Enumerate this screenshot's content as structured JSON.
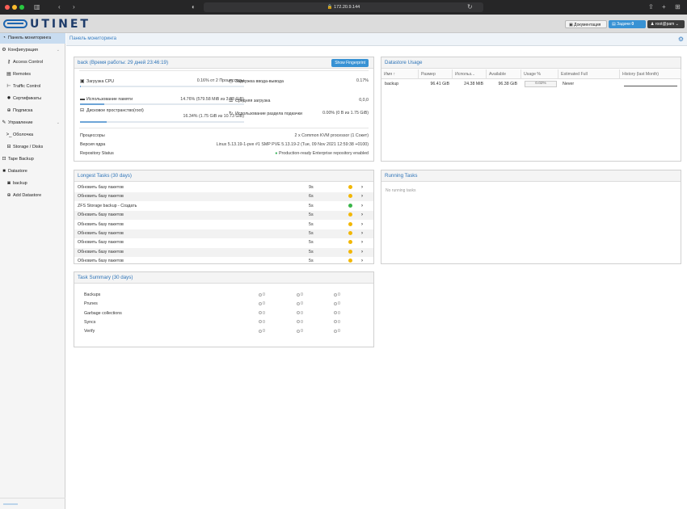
{
  "browser": {
    "url": "172.20.9.144",
    "traffic_colors": [
      "#ff5f57",
      "#febc2e",
      "#28c840"
    ]
  },
  "header": {
    "logo_text": "UTINET",
    "doc_label": "Документация",
    "tasks_label": "Задачи",
    "tasks_count": "0",
    "user_label": "root@pam"
  },
  "sidebar": {
    "items": [
      {
        "label": "Панель мониторинга",
        "icon": "dashboard-icon",
        "glyph": "◔",
        "indent": false,
        "active": true
      },
      {
        "label": "Конфигурация",
        "icon": "gears-icon",
        "glyph": "⚙",
        "indent": false,
        "chevron": true
      },
      {
        "label": "Access Control",
        "icon": "key-icon",
        "glyph": "⚷",
        "indent": true
      },
      {
        "label": "Remotes",
        "icon": "server-icon",
        "glyph": "▤",
        "indent": true
      },
      {
        "label": "Traffic Control",
        "icon": "traffic-icon",
        "glyph": "⊢",
        "indent": true
      },
      {
        "label": "Сертификаты",
        "icon": "certificate-icon",
        "glyph": "✹",
        "indent": true
      },
      {
        "label": "Подписка",
        "icon": "support-icon",
        "glyph": "⊕",
        "indent": true
      },
      {
        "label": "Управление",
        "icon": "wrench-icon",
        "glyph": "✎",
        "indent": false,
        "chevron": true
      },
      {
        "label": "Оболочка",
        "icon": "terminal-icon",
        "glyph": ">_",
        "indent": true
      },
      {
        "label": "Storage / Disks",
        "icon": "disk-icon",
        "glyph": "⊟",
        "indent": true
      },
      {
        "label": "Tape Backup",
        "icon": "tape-icon",
        "glyph": "⊡",
        "indent": false
      },
      {
        "label": "Datastore",
        "icon": "datastore-icon",
        "glyph": "■",
        "indent": false
      },
      {
        "label": "backup",
        "icon": "database-icon",
        "glyph": "◙",
        "indent": true
      },
      {
        "label": "Add Datastore",
        "icon": "plus-circle-icon",
        "glyph": "⊕",
        "indent": true
      }
    ]
  },
  "tab": {
    "title": "Панель мониторинга"
  },
  "status_panel": {
    "title": "back (Время работы: 29 дней 23:46:19)",
    "fingerprint_label": "Show Fingerprint",
    "cpu_label": "Загрузка CPU",
    "cpu_value": "0.16% от 2 Процессоры",
    "cpu_fraction": 0.0016,
    "iodelay_label": "Задержка ввода-вывода",
    "iodelay_value": "0.17%",
    "mem_label": "Использование памяти",
    "mem_value": "14.76% (579.58 MiB из 3.83 GiB)",
    "mem_fraction": 0.1476,
    "load_label": "Средняя загрузка",
    "load_value": "0,0,0",
    "disk_label": "Дисковое пространство(root)",
    "disk_value": "16.34% (1.75 GiB из 10.73 GiB)",
    "disk_fraction": 0.1634,
    "swap_label": "Использование раздела подкачки",
    "swap_value": "0.00% (0 B из 1.75 GiB)",
    "cpus_label": "Процессоры",
    "cpus_value": "2 x Common KVM processor (1 Сокет)",
    "kernel_label": "Версия ядра",
    "kernel_value": "Linux 5.13.19-1-pve #1 SMP PVE 5.13.19-2 (Tue, 09 Nov 2021 12:59:38 +0100)",
    "repo_label": "Repository Status",
    "repo_value": "Production-ready Enterprise repository enabled"
  },
  "datastore_usage": {
    "title": "Datastore Usage",
    "columns": [
      "Имя ↑",
      "Размер",
      "Использ...",
      "Available",
      "Usage %",
      "Estimated Full",
      "History (last Month)"
    ],
    "rows": [
      {
        "name": "backup",
        "size": "96.41 GiB",
        "used": "24.38 MiB",
        "available": "96.38 GiB",
        "usage": "0.02%",
        "usage_fraction": 0.0002,
        "estimated": "Never"
      }
    ]
  },
  "longest_tasks": {
    "title": "Longest Tasks (30 days)",
    "rows": [
      {
        "task": "Обновить базу пакетов",
        "duration": "9s",
        "status": "warning"
      },
      {
        "task": "Обновить базу пакетов",
        "duration": "6s",
        "status": "warning"
      },
      {
        "task": "ZFS Storage backup - Создать",
        "duration": "5s",
        "status": "ok"
      },
      {
        "task": "Обновить базу пакетов",
        "duration": "5s",
        "status": "warning"
      },
      {
        "task": "Обновить базу пакетов",
        "duration": "5s",
        "status": "warning"
      },
      {
        "task": "Обновить базу пакетов",
        "duration": "5s",
        "status": "warning"
      },
      {
        "task": "Обновить базу пакетов",
        "duration": "5s",
        "status": "warning"
      },
      {
        "task": "Обновить базу пакетов",
        "duration": "5s",
        "status": "warning"
      },
      {
        "task": "Обновить базу пакетов",
        "duration": "5s",
        "status": "warning"
      }
    ]
  },
  "running_tasks": {
    "title": "Running Tasks",
    "empty_text": "No running tasks"
  },
  "task_summary": {
    "title": "Task Summary (30 days)",
    "rows": [
      {
        "label": "Backups",
        "c1": "0",
        "c2": "0",
        "c3": "0"
      },
      {
        "label": "Prunes",
        "c1": "0",
        "c2": "0",
        "c3": "0"
      },
      {
        "label": "Garbage collections",
        "c1": "0",
        "c2": "0",
        "c3": "0"
      },
      {
        "label": "Syncs",
        "c1": "0",
        "c2": "0",
        "c3": "0"
      },
      {
        "label": "Verify",
        "c1": "0",
        "c2": "0",
        "c3": "0"
      }
    ]
  },
  "colors": {
    "accent": "#3892d4",
    "warning": "#f2b705",
    "ok": "#39b54a"
  }
}
